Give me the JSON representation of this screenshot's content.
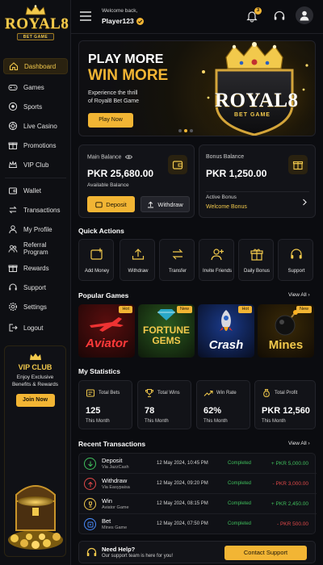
{
  "brand": {
    "name": "ROYAL8",
    "tagline": "BET GAME"
  },
  "sidebar": {
    "items": [
      {
        "label": "Dashboard"
      },
      {
        "label": "Games"
      },
      {
        "label": "Sports"
      },
      {
        "label": "Live Casino"
      },
      {
        "label": "Promotions"
      },
      {
        "label": "VIP Club"
      },
      {
        "label": "Wallet"
      },
      {
        "label": "Transactions"
      },
      {
        "label": "My Profile"
      },
      {
        "label": "Referral Program"
      },
      {
        "label": "Rewards"
      },
      {
        "label": "Support"
      },
      {
        "label": "Settings"
      },
      {
        "label": "Logout"
      }
    ],
    "vip": {
      "title": "VIP CLUB",
      "desc1": "Enjoy Exclusive",
      "desc2": "Benefits & Rewards",
      "button": "Join Now"
    }
  },
  "header": {
    "welcome": "Welcome back,",
    "username": "Player123",
    "notifications": "3"
  },
  "banner": {
    "line1": "PLAY MORE",
    "line2": "WIN MORE",
    "desc1": "Experience the thrill",
    "desc2": "of Royal8 Bet Game",
    "button": "Play Now",
    "logo_name": "ROYAL8",
    "logo_sub": "BET GAME",
    "slides_total": 3,
    "active_slide": 1
  },
  "main_balance": {
    "label": "Main Balance",
    "amount": "PKR 25,680.00",
    "sub": "Available Balance",
    "deposit": "Deposit",
    "withdraw": "Withdraw"
  },
  "bonus_balance": {
    "label": "Bonus Balance",
    "amount": "PKR 1,250.00",
    "active_label": "Active Bonus",
    "active_value": "Welcome Bonus"
  },
  "quick_actions": {
    "title": "Quick Actions",
    "items": [
      {
        "label": "Add Money"
      },
      {
        "label": "Withdraw"
      },
      {
        "label": "Transfer"
      },
      {
        "label": "Invite Friends"
      },
      {
        "label": "Daily Bonus"
      },
      {
        "label": "Support"
      }
    ]
  },
  "popular_games": {
    "title": "Popular Games",
    "view_all": "View All",
    "items": [
      {
        "name": "Aviator",
        "tag": "Hot"
      },
      {
        "name": "FORTUNE GEMS",
        "tag": "New"
      },
      {
        "name": "Crash",
        "tag": "Hot"
      },
      {
        "name": "Mines",
        "tag": "New"
      }
    ]
  },
  "stats": {
    "title": "My Statistics",
    "items": [
      {
        "label": "Total Bets",
        "value": "125",
        "period": "This Month"
      },
      {
        "label": "Total Wins",
        "value": "78",
        "period": "This Month"
      },
      {
        "label": "Win Rate",
        "value": "62%",
        "period": "This Month"
      },
      {
        "label": "Total Profit",
        "value": "PKR 12,560",
        "period": "This Month"
      }
    ]
  },
  "transactions": {
    "title": "Recent Transactions",
    "view_all": "View All",
    "items": [
      {
        "type": "Deposit",
        "via": "Via JazzCash",
        "date": "12 May 2024, 10:45 PM",
        "status": "Completed",
        "amount": "+ PKR 5,000.00"
      },
      {
        "type": "Withdraw",
        "via": "Via Easypaisa",
        "date": "12 May 2024, 09:20 PM",
        "status": "Completed",
        "amount": "- PKR 3,000.00"
      },
      {
        "type": "Win",
        "via": "Aviator Game",
        "date": "12 May 2024, 08:15 PM",
        "status": "Completed",
        "amount": "+ PKR 2,450.00"
      },
      {
        "type": "Bet",
        "via": "Mines Game",
        "date": "12 May 2024, 07:50 PM",
        "status": "Completed",
        "amount": "- PKR 500.00"
      }
    ]
  },
  "help": {
    "title": "Need Help?",
    "desc": "Our support team is here for you!",
    "button": "Contact Support"
  },
  "colors": {
    "accent": "#f2b534",
    "bg": "#0b0c10",
    "positive": "#3fbf5c",
    "negative": "#e04848"
  }
}
